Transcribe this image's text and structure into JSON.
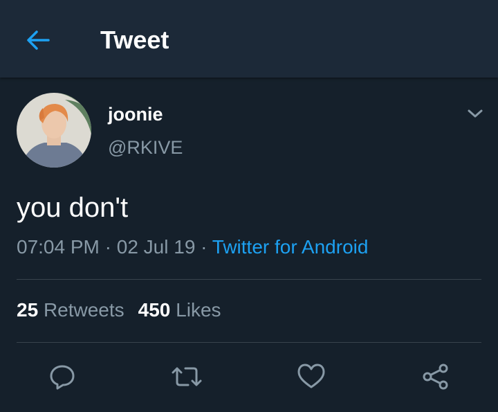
{
  "header": {
    "title": "Tweet",
    "back_icon": "arrow-left-icon"
  },
  "author": {
    "display_name": "joonie",
    "handle": "@RKIVE"
  },
  "tweet": {
    "text": "you don't",
    "time": "07:04 PM",
    "date": "02 Jul 19",
    "separator": "·",
    "source": "Twitter for Android"
  },
  "stats": {
    "retweets_count": "25",
    "retweets_label": "Retweets",
    "likes_count": "450",
    "likes_label": "Likes"
  },
  "actions": [
    "reply-icon",
    "retweet-icon",
    "like-icon",
    "share-icon"
  ],
  "colors": {
    "background": "#15202b",
    "header_background": "#1c2938",
    "accent": "#1da1f2",
    "secondary_text": "#8899a6",
    "divider": "#38444d"
  }
}
